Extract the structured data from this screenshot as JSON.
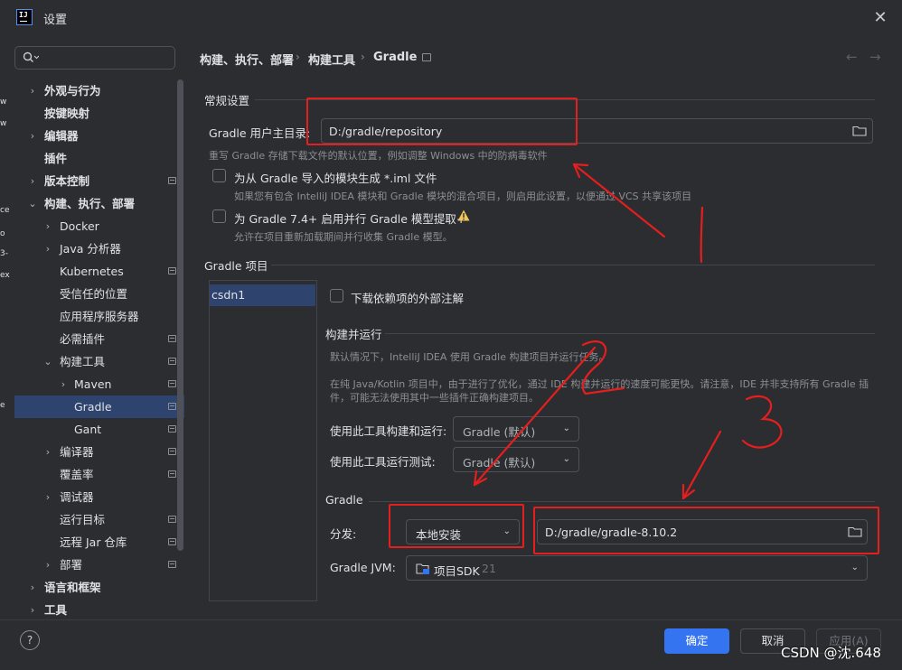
{
  "window": {
    "title": "设置",
    "app_icon": "IJ"
  },
  "search": {
    "placeholder": ""
  },
  "sidebar": {
    "items": [
      {
        "label": "外观与行为",
        "expand": "›"
      },
      {
        "label": "按键映射",
        "expand": ""
      },
      {
        "label": "编辑器",
        "expand": "›"
      },
      {
        "label": "插件",
        "expand": ""
      },
      {
        "label": "版本控制",
        "expand": "›"
      },
      {
        "label": "构建、执行、部署",
        "expand": "⌄"
      },
      {
        "label": "Docker",
        "expand": "›"
      },
      {
        "label": "Java 分析器",
        "expand": "›"
      },
      {
        "label": "Kubernetes",
        "expand": ""
      },
      {
        "label": "受信任的位置",
        "expand": ""
      },
      {
        "label": "应用程序服务器",
        "expand": ""
      },
      {
        "label": "必需插件",
        "expand": ""
      },
      {
        "label": "构建工具",
        "expand": "⌄"
      },
      {
        "label": "Maven",
        "expand": "›"
      },
      {
        "label": "Gradle",
        "expand": ""
      },
      {
        "label": "Gant",
        "expand": ""
      },
      {
        "label": "编译器",
        "expand": "›"
      },
      {
        "label": "覆盖率",
        "expand": ""
      },
      {
        "label": "调试器",
        "expand": "›"
      },
      {
        "label": "运行目标",
        "expand": ""
      },
      {
        "label": "远程 Jar 仓库",
        "expand": ""
      },
      {
        "label": "部署",
        "expand": "›"
      },
      {
        "label": "语言和框架",
        "expand": "›"
      },
      {
        "label": "工具",
        "expand": "›"
      }
    ]
  },
  "breadcrumb": {
    "part1": "构建、执行、部署",
    "part2": "构建工具",
    "part3": "Gradle",
    "sep": "›"
  },
  "general": {
    "section_title": "常规设置",
    "home_label": "Gradle 用户主目录:",
    "home_value": "D:/gradle/repository",
    "home_hint": "重写 Gradle 存储下载文件的默认位置，例如调整 Windows 中的防病毒软件",
    "iml_label": "为从 Gradle 导入的模块生成 *.iml 文件",
    "iml_hint": "如果您有包含 IntelliJ IDEA 模块和 Gradle 模块的混合项目，则启用此设置，以便通过 VCS 共享该项目",
    "parallel_label": "为 Gradle 7.4+ 启用并行 Gradle 模型提取+",
    "parallel_hint": "允许在项目重新加载期间并行收集 Gradle 模型。"
  },
  "projects": {
    "section_title": "Gradle 项目",
    "items": [
      "csdn1"
    ],
    "download_label": "下载依赖项的外部注解",
    "build_section": "构建并运行",
    "build_desc": "默认情况下，IntelliJ IDEA 使用 Gradle 构建项目并运行任务。",
    "build_desc2_line1": "在纯 Java/Kotlin 项目中，由于进行了优化，通过 IDE 构建并运行的速度可能更快。请注意，IDE 并非支持所有 Gradle 插",
    "build_desc2_line2": "件，可能无法使用其中一些插件正确构建项目。",
    "build_run_label": "使用此工具构建和运行:",
    "build_run_value": "Gradle (默认)",
    "test_label": "使用此工具运行测试:",
    "test_value": "Gradle (默认)",
    "gradle_section": "Gradle",
    "dist_label": "分发:",
    "dist_value": "本地安装",
    "dist_path": "D:/gradle/gradle-8.10.2",
    "jvm_label": "Gradle JVM:",
    "jvm_value": "项目SDK",
    "jvm_version": "21"
  },
  "footer": {
    "ok": "确定",
    "cancel": "取消",
    "apply": "应用(A)",
    "help": "?"
  },
  "annotations": {
    "n1": "1",
    "n2": "2",
    "n3": "3",
    "color": "#e51e1e"
  },
  "watermark": "CSDN @沈.648",
  "left_strip": [
    "w",
    "w",
    "ce",
    "o",
    "3-",
    "ex",
    "e"
  ],
  "colors": {
    "accent": "#3574f0",
    "selection": "#2e436e",
    "background": "#2b2d30",
    "warning": "#f2c55c"
  }
}
